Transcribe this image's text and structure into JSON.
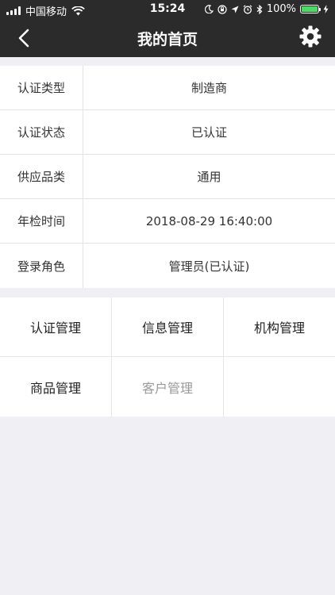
{
  "status_bar": {
    "carrier": "中国移动",
    "time": "15:24",
    "battery": "100%",
    "icons": [
      "signal-icon",
      "wifi-icon",
      "moon-icon",
      "lock-rotation-icon",
      "location-icon",
      "alarm-icon",
      "bluetooth-icon",
      "battery-icon",
      "charging-icon"
    ]
  },
  "nav": {
    "title": "我的首页",
    "back_icon": "chevron-left-icon",
    "settings_icon": "gear-icon"
  },
  "info": {
    "rows": [
      {
        "label": "认证类型",
        "value": "制造商"
      },
      {
        "label": "认证状态",
        "value": "已认证"
      },
      {
        "label": "供应品类",
        "value": "通用"
      },
      {
        "label": "年检时间",
        "value": "2018-08-29 16:40:00"
      },
      {
        "label": "登录角色",
        "value": "管理员(已认证)"
      }
    ]
  },
  "menu": {
    "items": [
      {
        "label": "认证管理",
        "enabled": true
      },
      {
        "label": "信息管理",
        "enabled": true
      },
      {
        "label": "机构管理",
        "enabled": true
      },
      {
        "label": "商品管理",
        "enabled": true
      },
      {
        "label": "客户管理",
        "enabled": false
      }
    ]
  },
  "colors": {
    "nav_bg": "#2b2b2b",
    "page_bg": "#efeff4",
    "battery_green": "#4cd964",
    "disabled_text": "#999999"
  }
}
